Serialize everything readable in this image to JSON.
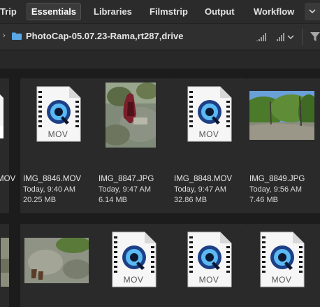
{
  "tabs": [
    {
      "label": "Trip",
      "active": false
    },
    {
      "label": "Essentials",
      "active": true
    },
    {
      "label": "Libraries",
      "active": false
    },
    {
      "label": "Filmstrip",
      "active": false
    },
    {
      "label": "Output",
      "active": false
    },
    {
      "label": "Workflow",
      "active": false
    }
  ],
  "path": {
    "folder": "PhotoCap-05.07.23-Rama,rt287,drive"
  },
  "icons": {
    "more": "chevron-down-icon",
    "folder": "folder-icon",
    "sort_desc": "sort-descending-icon",
    "sort_menu": "sort-menu-icon",
    "filter": "filter-icon",
    "file_type": "quicktime-icon"
  },
  "file_badge": "MOV",
  "row1": [
    {
      "name": "MOV",
      "date": "",
      "size": "",
      "kind": "mov-partial"
    },
    {
      "name": "IMG_8846.MOV",
      "date": "Today, 9:40 AM",
      "size": "20.25 MB",
      "kind": "mov"
    },
    {
      "name": "IMG_8847.JPG",
      "date": "Today, 9:47 AM",
      "size": "6.14 MB",
      "kind": "photo-pack"
    },
    {
      "name": "IMG_8848.MOV",
      "date": "Today, 9:47 AM",
      "size": "32.86 MB",
      "kind": "mov"
    },
    {
      "name": "IMG_8849.JPG",
      "date": "Today, 9:56 AM",
      "size": "7.46 MB",
      "kind": "photo-land"
    }
  ],
  "colors": {
    "accent_folder": "#5aa8e6",
    "background": "#1c1c1c",
    "cell": "#2a2a2a"
  }
}
